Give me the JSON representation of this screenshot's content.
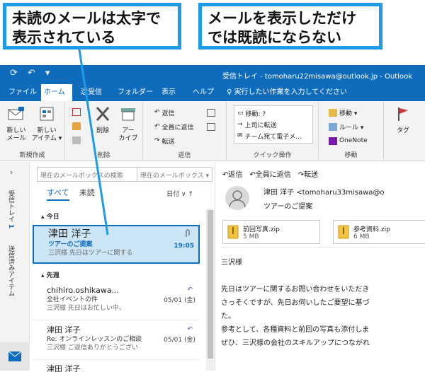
{
  "callouts": {
    "left": [
      "未読のメールは太字で",
      "表示されている"
    ],
    "right": [
      "メールを表示しただけ",
      "では既読にならない"
    ]
  },
  "window": {
    "title": "受信トレイ - tomoharu22misawa@outlook.jp  -  Outlook"
  },
  "menu_tabs": [
    "ファイル",
    "ホーム",
    "送受信",
    "フォルダー",
    "表示",
    "ヘルプ",
    "実行したい作業を入力してください"
  ],
  "ribbon": {
    "new_mail": [
      "新しい",
      "メール"
    ],
    "new_items": [
      "新しい",
      "アイテム ▾"
    ],
    "group_new": "新規作成",
    "delete": "削除",
    "archive": [
      "アー",
      "カイブ"
    ],
    "group_delete": "削除",
    "reply": "返信",
    "reply_all": "全員に返信",
    "forward": "転送",
    "group_reply": "返信",
    "quick_steps": [
      "移動: ?",
      "上司に転送",
      "チーム宛て電子メ..."
    ],
    "group_quick": "クイック操作",
    "move": "移動 ▾",
    "rules": "ルール ▾",
    "onenote": "OneNote",
    "group_move": "移動",
    "tags": "タグ"
  },
  "nav": {
    "inbox": "受信トレイ",
    "inbox_count": "1",
    "sent": "送信済みアイテム"
  },
  "list": {
    "search_placeholder": "現在のメールボックスの検索",
    "search_scope": "現在のメールボックス ▾",
    "filter_all": "すべて",
    "filter_unread": "未読",
    "sort": "日付 ∨   ↑",
    "group_today": "▴ 今日",
    "group_last_week": "▴ 先週",
    "mails": [
      {
        "sender": "津田 洋子",
        "subject": "ツアーのご提案",
        "preview": "三沢様  先日はツアーに関する",
        "date": "19:05"
      },
      {
        "sender": "chihiro.oshikawa...",
        "subject": "全社イベントの件",
        "preview": "三沢様  先日はお忙しい中、",
        "date": "05/01 (金)"
      },
      {
        "sender": "津田 洋子",
        "subject": "Re: オンラインレッスンのご相談",
        "preview": "三沢様  ご返信ありがとうござい",
        "date": "05/01 (金)"
      },
      {
        "sender": "津田 洋子",
        "subject": "",
        "preview": "",
        "date": ""
      }
    ]
  },
  "reading": {
    "reply": "返信",
    "reply_all": "全員に返信",
    "forward": "転送",
    "from": "津田 洋子 <tomoharu33misawa@o",
    "subject": "ツアーのご提案",
    "attachments": [
      {
        "name": "前回写真.zip",
        "size": "5 MB"
      },
      {
        "name": "参考資料.zip",
        "size": "6 MB"
      }
    ],
    "body": [
      "三沢様",
      "",
      "先日はツアーに関するお問い合わせをいただき",
      "さっそくですが、先日お伺いしたご要望に基づ",
      "た。",
      "参考として、各種資料と前回の写真も添付しま",
      "ぜひ、三沢様の会社のスキルアップにつながれ"
    ]
  },
  "colors": {
    "accent": "#0f6cbd",
    "callout_border": "#1e9be6",
    "unread_bg": "#cde6f7"
  }
}
